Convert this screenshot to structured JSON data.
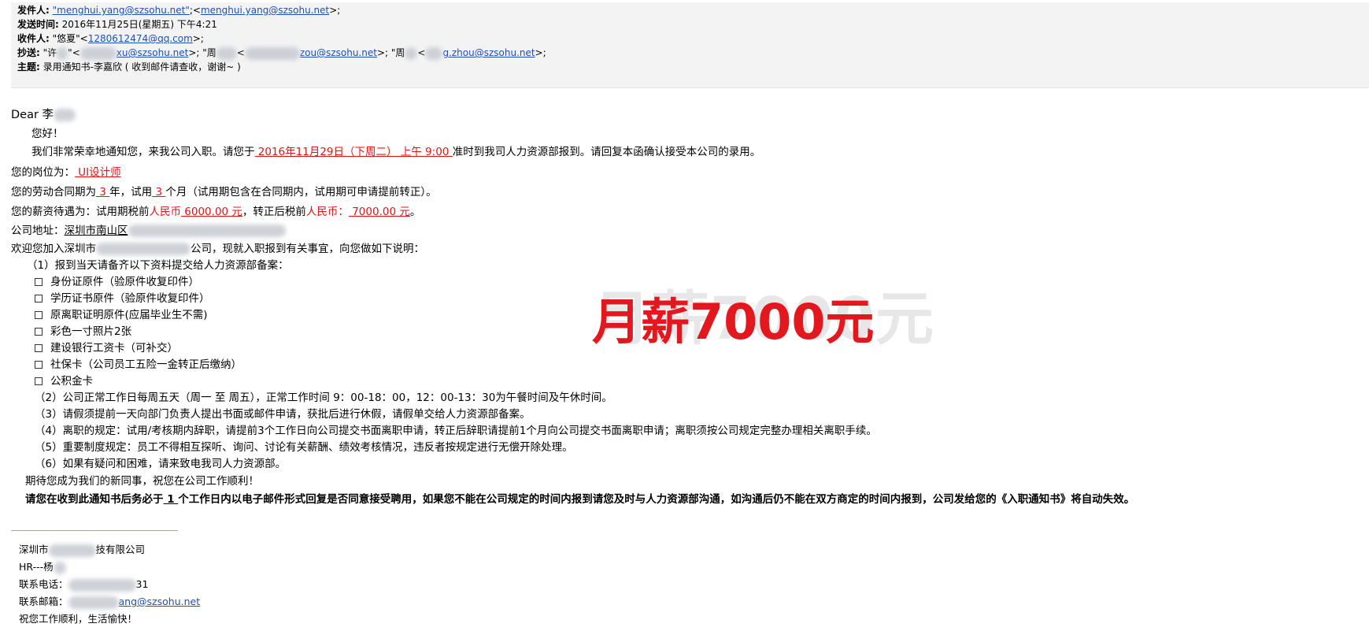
{
  "header": {
    "from_label": "发件人:",
    "from_name": "\"menghui.yang@szsohu.net\"",
    "from_sep": ";<",
    "from_email": "menghui.yang@szsohu.net",
    "from_end": ">;",
    "sent_label": "发送时间:",
    "sent_value": "2016年11月25日(星期五) 下午4:21",
    "to_label": "收件人:",
    "to_name": "\"悠夏\"<",
    "to_email": "1280612474@qq.com",
    "to_end": ">;",
    "cc_label": "抄送:",
    "cc_1_name": "\"许",
    "cc_1_mid": "\"<",
    "cc_1_email": "xu@szsohu.net",
    "cc_1_end": ">; \"周",
    "cc_2_mid": "<",
    "cc_2_email": "zou@szsohu.net",
    "cc_2_end": ">; \"周",
    "cc_3_mid": "<",
    "cc_3_email": "g.zhou@szsohu.net",
    "cc_3_end": ">;",
    "subject_label": "主题:",
    "subject_value": "录用通知书-李嘉欣 ( 收到邮件请查收，谢谢~ )"
  },
  "body": {
    "dear": "Dear 李",
    "hello": "您好！",
    "intro_a": "我们非常荣幸地通知您，来我公司入职。请您于",
    "intro_date": " 2016年11月29日（下周二） 上午 9:00 ",
    "intro_b": "准时到我司人力资源部报到。请回复本函确认接受本公司的录用。",
    "position_label": "您的岗位为：",
    "position_value": "  UI设计师  ",
    "contract_a": "您的劳动合同期为",
    "contract_years": "  3  ",
    "contract_b": "年，试用",
    "contract_months": " 3 ",
    "contract_c": "个月（试用期包含在合同期内，试用期可申请提前转正）。",
    "salary_a": "您的薪资待遇为：试用期税前",
    "salary_rmb1": "人民币",
    "salary_trial": " 6000.00 元",
    "salary_b": "，转正后税前",
    "salary_rmb2": "人民币：",
    "salary_formal": " 7000.00 元",
    "salary_end": "。",
    "address_label": "公司地址：",
    "address_value": "深圳市南山区",
    "welcome_a": "欢迎您加入深圳市",
    "welcome_b": "公司，现就入职报到有关事宜，向您做如下说明：",
    "item1_title": "（1）报到当天请备齐以下资料提交给人力资源部备案：",
    "checklist": [
      "身份证原件（验原件收复印件）",
      "学历证书原件（验原件收复印件）",
      "原离职证明原件(应届毕业生不需)",
      "彩色一寸照片2张",
      "建设银行工资卡（可补交）",
      "社保卡（公司员工五险一金转正后缴纳）",
      "公积金卡"
    ],
    "item2": "（2）公司正常工作日每周五天（周一 至 周五），正常工作时间 9：00-18：00，12：00-13：30为午餐时间及午休时间。",
    "item3": "（3）请假须提前一天向部门负责人提出书面或邮件申请，获批后进行休假，请假单交给人力资源部备案。",
    "item4": "（4）离职的规定：试用/考核期内辞职，请提前3个工作日向公司提交书面离职申请，转正后辞职请提前1个月向公司提交书面离职申请；离职须按公司规定完整办理相关离职手续。",
    "item5": "（5）重要制度规定：员工不得相互探听、询问、讨论有关薪酬、绩效考核情况，违反者按规定进行无偿开除处理。",
    "item6": "（6）如果有疑问和困难，请来致电我司人力资源部。",
    "closing": "期待您成为我们的新同事，祝您在公司工作顺利！",
    "notice_a": "请您在收到此通知书后务必于",
    "notice_days": " 1 ",
    "notice_b": "个工作日内以电子邮件形式回复是否同意接受聘用，如果您不能在公司规定的时间内报到请您及时与人力资源部沟通，如沟通后仍不能在双方商定的时间内报到，公司发给您的《入职通知书》将自动失效。"
  },
  "signature": {
    "company_a": "深圳市",
    "company_b": "技有限公司",
    "hr": "HR---杨",
    "phone_label": "联系电话：",
    "phone_end": "31",
    "email_label": "联系邮箱：",
    "email_end": "ang@szsohu.net",
    "wish": "祝您工作顺利，生活愉快！"
  },
  "watermark": {
    "text": "月薪7000元"
  },
  "colors": {
    "link": "#1f4fb4",
    "highlight": "#e01414",
    "watermark": "#e3181f",
    "header_bg": "#f3f3f3"
  }
}
